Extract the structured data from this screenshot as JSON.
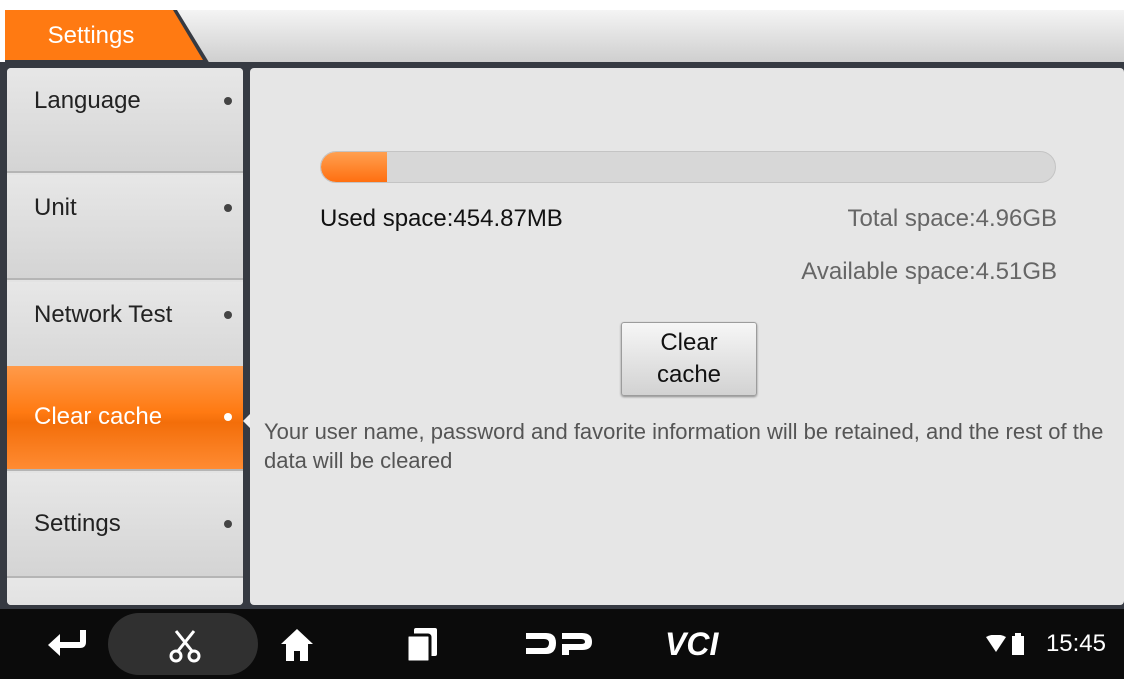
{
  "header": {
    "title": "Settings"
  },
  "sidebar": {
    "items": [
      {
        "label": "Language"
      },
      {
        "label": "Unit"
      },
      {
        "label": "Network Test"
      },
      {
        "label": "Clear cache",
        "active": true
      },
      {
        "label": "Settings"
      }
    ]
  },
  "storage": {
    "used_label": "Used space:454.87MB",
    "total_label": "Total space:4.96GB",
    "available_label": "Available space:4.51GB",
    "used_fraction": 0.09
  },
  "actions": {
    "clear_cache_label": "Clear cache"
  },
  "note": "Your user name, password and favorite information will be retained, and the rest of the data will be cleared",
  "status": {
    "time": "15:45"
  },
  "navbar": {
    "icons": [
      "back-icon",
      "scissors-icon",
      "home-icon",
      "recents-icon",
      "dp-logo-icon",
      "vci-icon"
    ]
  },
  "colors": {
    "accent": "#ff7a12",
    "frame": "#363a42",
    "navbar": "#0b0b0b"
  }
}
